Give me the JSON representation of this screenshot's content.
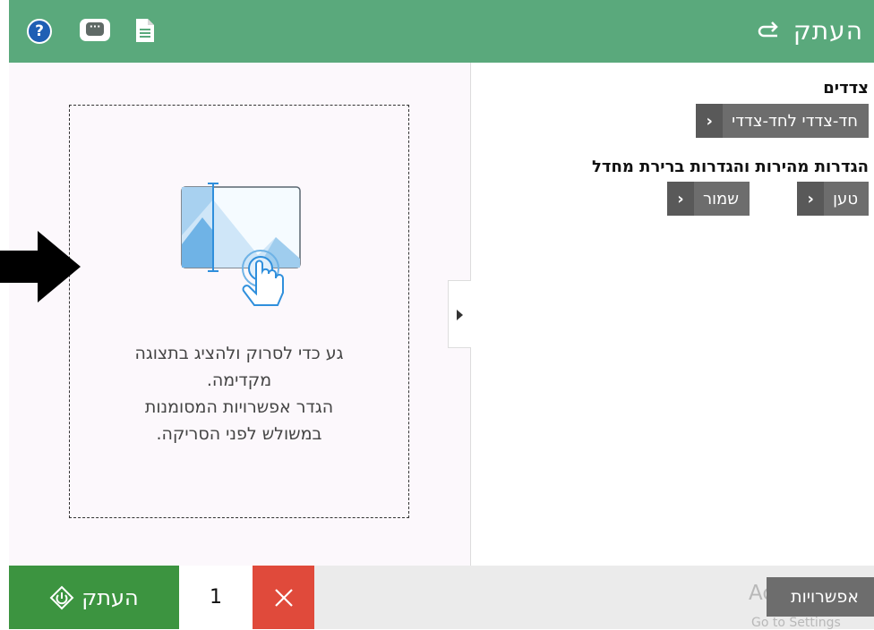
{
  "header": {
    "title": "העתק",
    "help_icon": "?",
    "chat_icon": "···",
    "colors": {
      "bar": "#5aa97c"
    }
  },
  "preview": {
    "hint_lines": [
      "גע כדי לסרוק ולהציג בתצוגה",
      "מקדימה.",
      "הגדר אפשרויות המסומנות",
      "במשולש לפני הסריקה."
    ]
  },
  "settings": {
    "sides_label": "צדדים",
    "sides_value": "חד-צדדי לחד-צדדי",
    "presets_label": "הגדרות מהירות והגדרות ברירת מחדל",
    "load_label": "טען",
    "save_label": "שמור"
  },
  "bottom": {
    "start_label": "העתק",
    "quantity": "1",
    "options_label": "אפשרויות",
    "watermark_line1": "Ac",
    "watermark_line2": "Go to Settings",
    "colors": {
      "start": "#3c9440",
      "clear": "#e04a3b"
    }
  }
}
